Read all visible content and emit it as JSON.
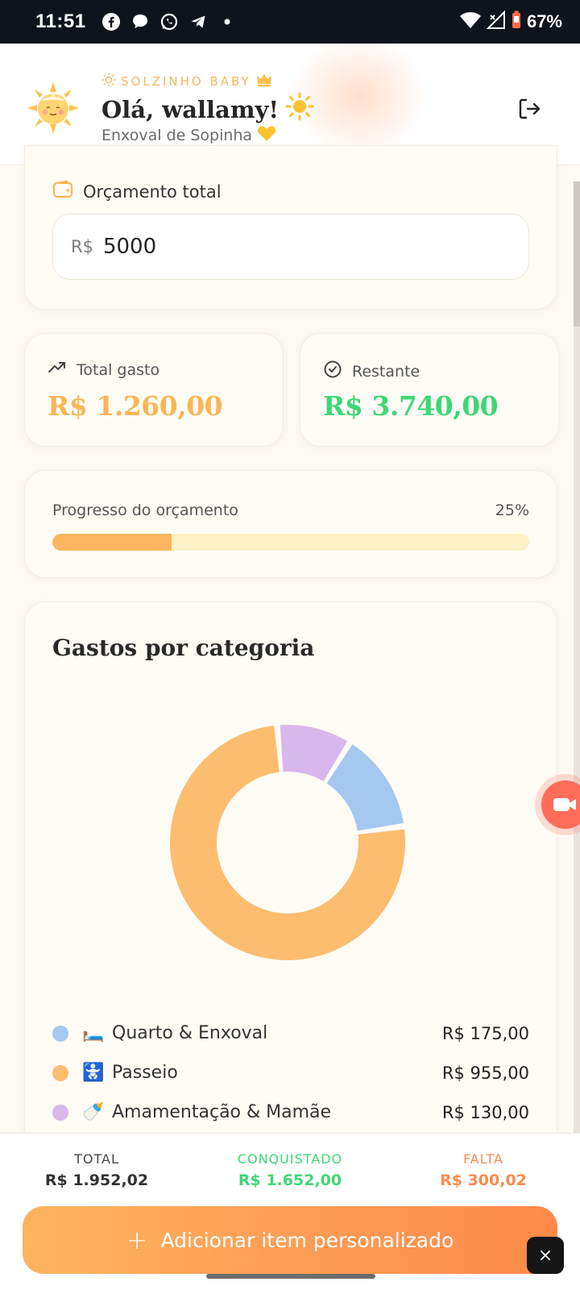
{
  "status_bar": {
    "time": "11:51",
    "battery": "67%",
    "app_icons": [
      "facebook-icon",
      "chat-bubble-icon",
      "whatsapp-icon",
      "telegram-icon",
      "dot-icon"
    ]
  },
  "header": {
    "brand": "SOLZINHO BABY",
    "greeting": "Olá, wallamy!",
    "subtitle": "Enxoval de Sopinha"
  },
  "budget": {
    "label": "Orçamento total",
    "prefix": "R$",
    "value": "5000"
  },
  "stats": {
    "spent_label": "Total gasto",
    "spent_value": "R$ 1.260,00",
    "remaining_label": "Restante",
    "remaining_value": "R$ 3.740,00"
  },
  "progress": {
    "label": "Progresso do orçamento",
    "percent_text": "25%",
    "fraction": 0.25
  },
  "categories": {
    "title": "Gastos por categoria",
    "items": [
      {
        "emoji": "🛏️",
        "name": "Quarto & Enxoval",
        "value": "R$ 175,00",
        "color": "#a5c8f0"
      },
      {
        "emoji": "🚼",
        "name": "Passeio",
        "value": "R$ 955,00",
        "color": "#fdbd6f"
      },
      {
        "emoji": "🍼",
        "name": "Amamentação & Mamãe",
        "value": "R$ 130,00",
        "color": "#d8b7ec"
      }
    ]
  },
  "chart_data": {
    "type": "pie",
    "categories": [
      "Quarto & Enxoval",
      "Passeio",
      "Amamentação & Mamãe"
    ],
    "values": [
      175,
      955,
      130
    ],
    "colors": [
      "#a5c8f0",
      "#fdbd6f",
      "#d8b7ec"
    ],
    "title": "Gastos por categoria"
  },
  "footer": {
    "total_label": "TOTAL",
    "total_value": "R$ 1.952,02",
    "achieved_label": "CONQUISTADO",
    "achieved_value": "R$ 1.652,00",
    "missing_label": "FALTA",
    "missing_value": "R$ 300,02",
    "add_button": "Adicionar item personalizado"
  },
  "colors": {
    "accent_orange": "#fdb660",
    "green": "#3ed775",
    "orange_text": "#fb8a4d"
  }
}
